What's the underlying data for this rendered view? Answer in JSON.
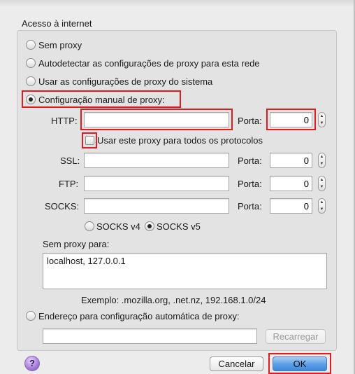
{
  "section_title": "Acesso à internet",
  "options": {
    "no_proxy": "Sem proxy",
    "auto_detect": "Autodetectar as configurações de proxy para esta rede",
    "system": "Usar as configurações de proxy do sistema",
    "manual": "Configuração manual de proxy:",
    "auto_config": "Endereço para configuração automática de proxy:"
  },
  "selected_option": "manual",
  "manual": {
    "http_label": "HTTP:",
    "http_value": "",
    "http_port_label": "Porta:",
    "http_port": "0",
    "use_for_all_label": "Usar este proxy para todos os protocolos",
    "use_for_all_checked": false,
    "ssl_label": "SSL:",
    "ssl_value": "",
    "ssl_port_label": "Porta:",
    "ssl_port": "0",
    "ftp_label": "FTP:",
    "ftp_value": "",
    "ftp_port_label": "Porta:",
    "ftp_port": "0",
    "socks_label": "SOCKS:",
    "socks_value": "",
    "socks_port_label": "Porta:",
    "socks_port": "0",
    "socks_v4_label": "SOCKS v4",
    "socks_v5_label": "SOCKS v5",
    "socks_selected": "v5"
  },
  "no_proxy_for": {
    "label": "Sem proxy para:",
    "value": "localhost, 127.0.0.1",
    "example": "Exemplo: .mozilla.org, .net.nz, 192.168.1.0/24"
  },
  "auto_config": {
    "url_value": "",
    "reload_label": "Recarregar"
  },
  "buttons": {
    "help": "?",
    "cancel": "Cancelar",
    "ok": "OK"
  },
  "colors": {
    "highlight": "#e01b24",
    "primary_button": "#5a9ee6",
    "help_button": "#a57bdb"
  },
  "icons": {
    "help": "help-icon",
    "stepper_up": "chevron-up-icon",
    "stepper_down": "chevron-down-icon"
  }
}
